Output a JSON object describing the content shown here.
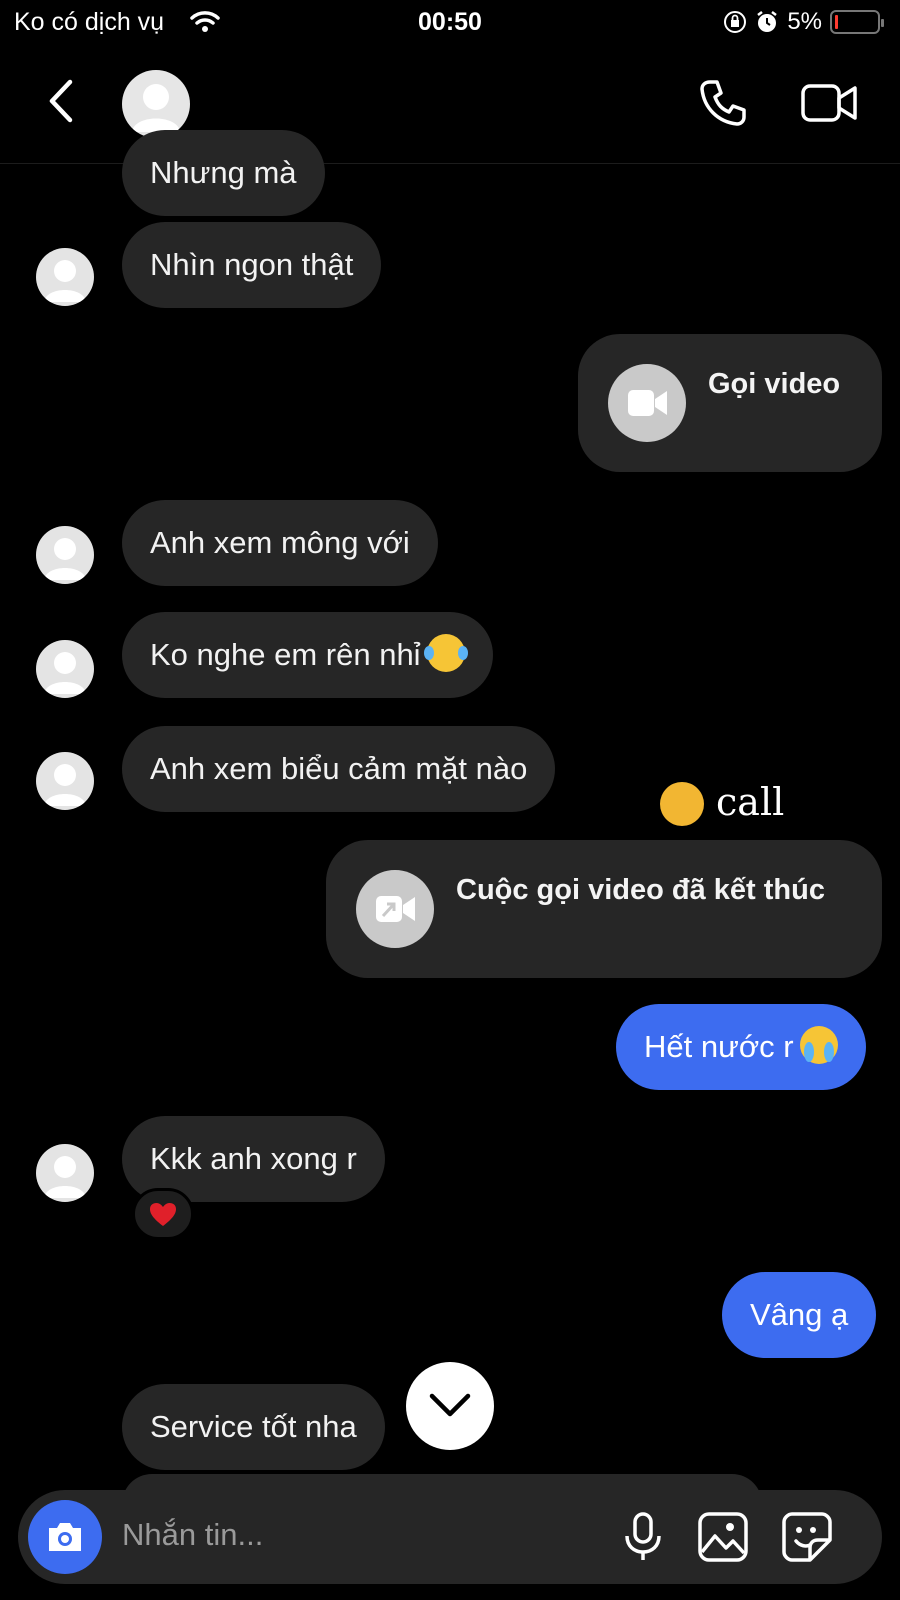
{
  "status_bar": {
    "carrier": "Ko có dịch vụ",
    "time": "00:50",
    "battery": "5%"
  },
  "header": {
    "back_icon": "chevron-left-icon",
    "call_icon": "phone-icon",
    "video_icon": "video-camera-icon"
  },
  "messages": [
    {
      "id": "m0",
      "from": "them",
      "text": "Nhưng mà"
    },
    {
      "id": "m1",
      "from": "them",
      "text": "Nhìn ngon thật"
    },
    {
      "id": "m2",
      "from": "me",
      "type": "call",
      "text": "Gọi video"
    },
    {
      "id": "m3",
      "from": "them",
      "text": "Anh xem mông với"
    },
    {
      "id": "m4",
      "from": "them",
      "text": "Ko nghe em rên nhỉ",
      "emoji": "face-with-tears-of-joy"
    },
    {
      "id": "m5",
      "from": "them",
      "text": "Anh xem biểu cảm mặt nào"
    },
    {
      "id": "m6",
      "from": "me",
      "type": "call",
      "text": "Cuộc gọi video đã kết thúc"
    },
    {
      "id": "m7",
      "from": "me",
      "text": "Hết nước r",
      "emoji": "loudly-crying-face"
    },
    {
      "id": "m8",
      "from": "them",
      "text": "Kkk anh xong r",
      "reaction": "red-heart"
    },
    {
      "id": "m9",
      "from": "me",
      "text": "Vâng ạ"
    },
    {
      "id": "m10",
      "from": "them",
      "text": "Service tốt nha"
    }
  ],
  "overlay_sticker": {
    "emoji": "face-with-hand-over-mouth",
    "text": "call"
  },
  "composer": {
    "placeholder": "Nhắn tin...",
    "camera_icon": "camera-icon",
    "mic_icon": "microphone-icon",
    "gallery_icon": "image-icon",
    "sticker_icon": "sticker-icon"
  },
  "colors": {
    "background": "#000000",
    "incoming_bubble": "#262626",
    "outgoing_bubble": "#3d6cf0",
    "accent": "#3d6cf0"
  }
}
